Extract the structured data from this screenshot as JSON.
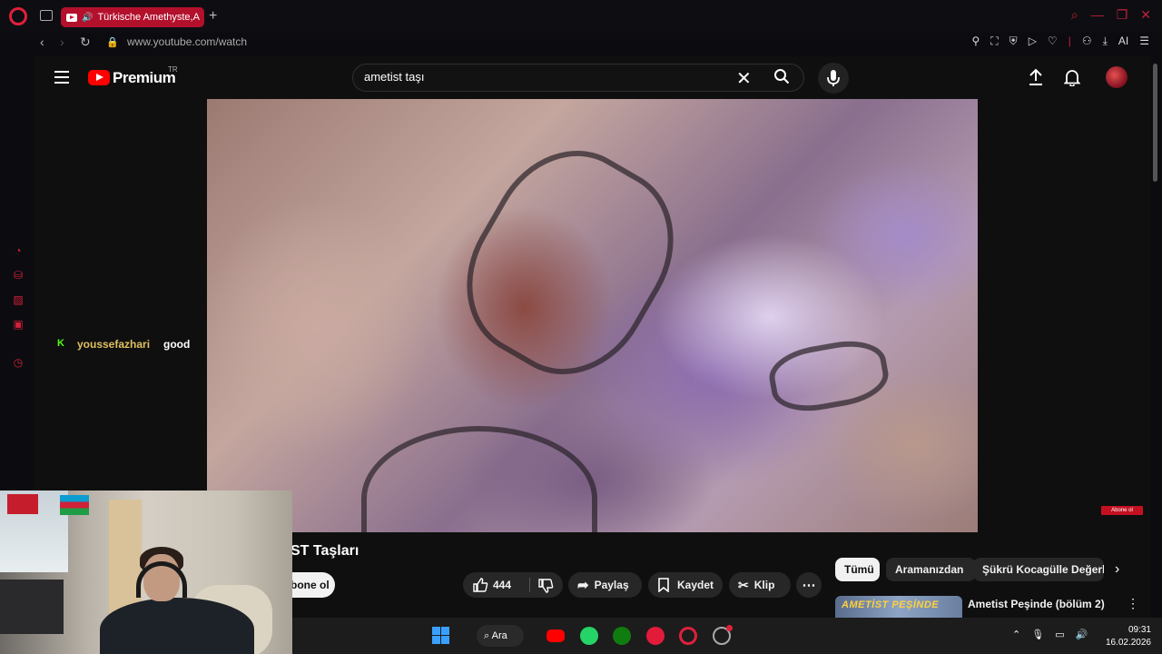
{
  "browser": {
    "tab_title": "Türkische Amethyste,A",
    "new_tab": "+",
    "url": "www.youtube.com/watch",
    "ai_label": "AI"
  },
  "youtube": {
    "brand": "Premium",
    "region": "TR",
    "search_value": "ametist taşı",
    "watermark": "Abone ol"
  },
  "video": {
    "title_visible": "ST Taşları",
    "subscribe_label": "bone ol",
    "likes": "444",
    "share_label": "Paylaş",
    "save_label": "Kaydet",
    "clip_label": "Klip",
    "more": "⋯"
  },
  "chips": {
    "all": "Tümü",
    "from_search": "Aramanızdan",
    "channel": "Şükrü Kocagülle Değerli"
  },
  "recommendation": {
    "thumb_text": "AMETİST PEŞİNDE",
    "title": "Ametist Peşinde (bölüm 2)"
  },
  "chat": {
    "badge": "K",
    "user": "youssefazhari",
    "message": "good"
  },
  "taskbar": {
    "search_label": "Ara",
    "time": "09:31",
    "date": "16.02.2026"
  },
  "colors": {
    "accent": "#e0203a",
    "yt_red": "#ff0000",
    "bg": "#0f0f0f"
  }
}
